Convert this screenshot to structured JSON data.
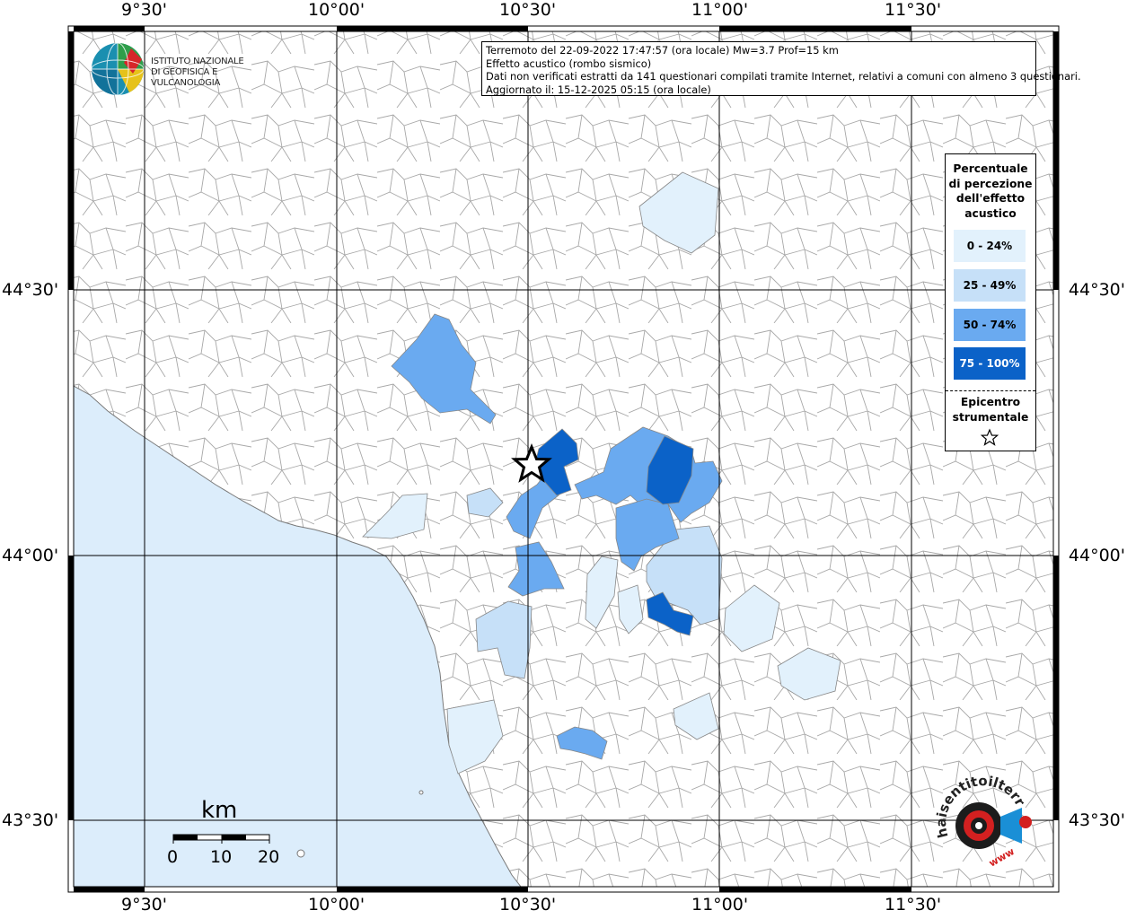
{
  "info": {
    "line1": "Terremoto del 22-09-2022 17:47:57 (ora locale) Mw=3.7 Prof=15 km",
    "line2": "Effetto acustico (rombo sismico)",
    "line3": "Dati non verificati estratti da 141 questionari compilati tramite Internet, relativi a comuni con almeno 3 questionari.",
    "line4": "Aggiornato il: 15-12-2025 05:15 (ora locale)"
  },
  "logo": {
    "line1": "ISTITUTO NAZIONALE",
    "line2": "DI GEOFISICA E VULCANOLOGIA",
    "icon": "ingv-globe-icon"
  },
  "axes": {
    "top": [
      "9°30'",
      "10°00'",
      "10°30'",
      "11°00'",
      "11°30'"
    ],
    "bottom": [
      "9°30'",
      "10°00'",
      "10°30'",
      "11°00'",
      "11°30'"
    ],
    "left": [
      "44°30'",
      "44°00'",
      "43°30'"
    ],
    "right": [
      "44°30'",
      "44°00'",
      "43°30'"
    ]
  },
  "legend": {
    "title_lines": [
      "Percentuale",
      "di percezione",
      "dell'effetto",
      "acustico"
    ],
    "classes": [
      {
        "label": "0 - 24%",
        "color": "#e2f1fc"
      },
      {
        "label": "25 - 49%",
        "color": "#c6e0f8"
      },
      {
        "label": "50 - 74%",
        "color": "#6aaaf0"
      },
      {
        "label": "75 - 100%",
        "color": "#0b62c8"
      }
    ],
    "epicenter_lines": [
      "Epicentro",
      "strumentale"
    ],
    "epicenter_icon": "star-icon"
  },
  "scale": {
    "unit": "km",
    "ticks": [
      "0",
      "10",
      "20"
    ]
  },
  "colors": {
    "sea": "#dcedfb",
    "land": "#ffffff",
    "border": "#9a9a9a",
    "grid": "#000000"
  },
  "brand_logo": {
    "text": "haisentitoilterremoto.it",
    "url_text": "www",
    "icon": "haisentito-logo-icon"
  }
}
